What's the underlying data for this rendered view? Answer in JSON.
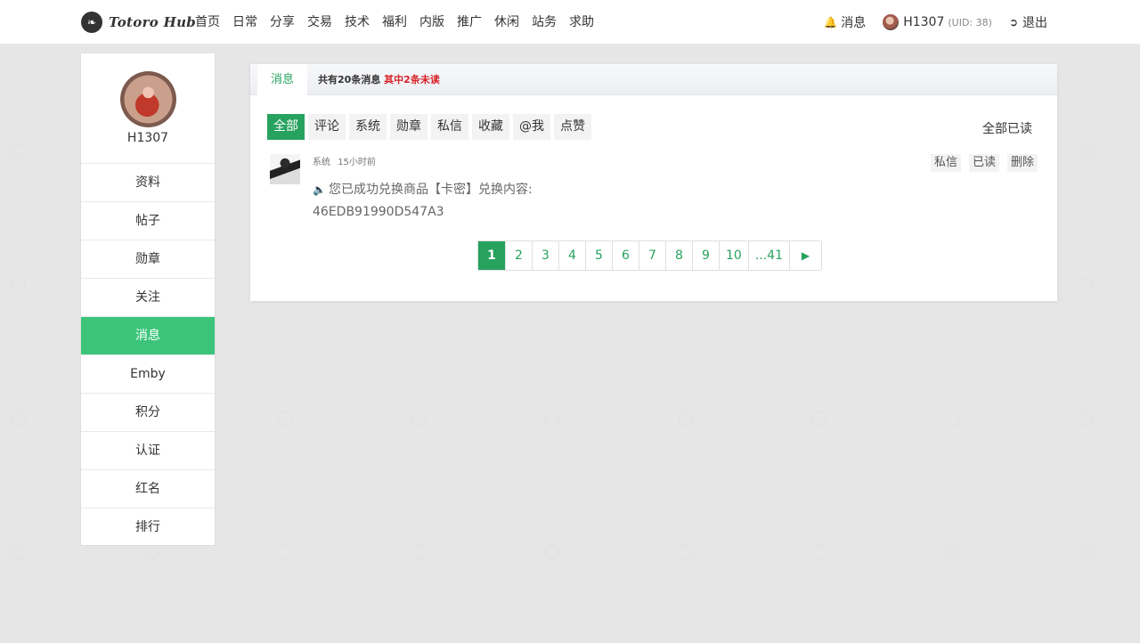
{
  "header": {
    "logo_text": "Totoro Hub",
    "nav": [
      "首页",
      "日常",
      "分享",
      "交易",
      "技术",
      "福利",
      "内版",
      "推广",
      "休闲",
      "站务",
      "求助"
    ],
    "messages_label": "消息",
    "username": "H1307",
    "uid": "(UID: 38)",
    "logout_label": "退出"
  },
  "sidebar": {
    "username": "H1307",
    "items": [
      "资料",
      "帖子",
      "勋章",
      "关注",
      "消息",
      "Emby",
      "积分",
      "认证",
      "红名",
      "排行"
    ],
    "active_index": 4
  },
  "panel": {
    "tab_label": "消息",
    "summary_prefix": "共有20条消息",
    "summary_unread": "其中2条未读",
    "filters": [
      "全部",
      "评论",
      "系统",
      "勋章",
      "私信",
      "收藏",
      "@我",
      "点赞"
    ],
    "active_filter": 0,
    "mark_all_read": "全部已读"
  },
  "message": {
    "type": "系统",
    "time": "15小时前",
    "actions": [
      "私信",
      "已读",
      "删除"
    ],
    "text": "您已成功兑换商品【卡密】兑换内容:",
    "code": "46EDB91990D547A3"
  },
  "pagination": {
    "pages": [
      "1",
      "2",
      "3",
      "4",
      "5",
      "6",
      "7",
      "8",
      "9",
      "10",
      "...41"
    ],
    "current": "1",
    "next_icon": "play-icon"
  },
  "colors": {
    "accent": "#27a25e",
    "sidebar_active": "#3cc57a",
    "unread": "#d9232a"
  }
}
